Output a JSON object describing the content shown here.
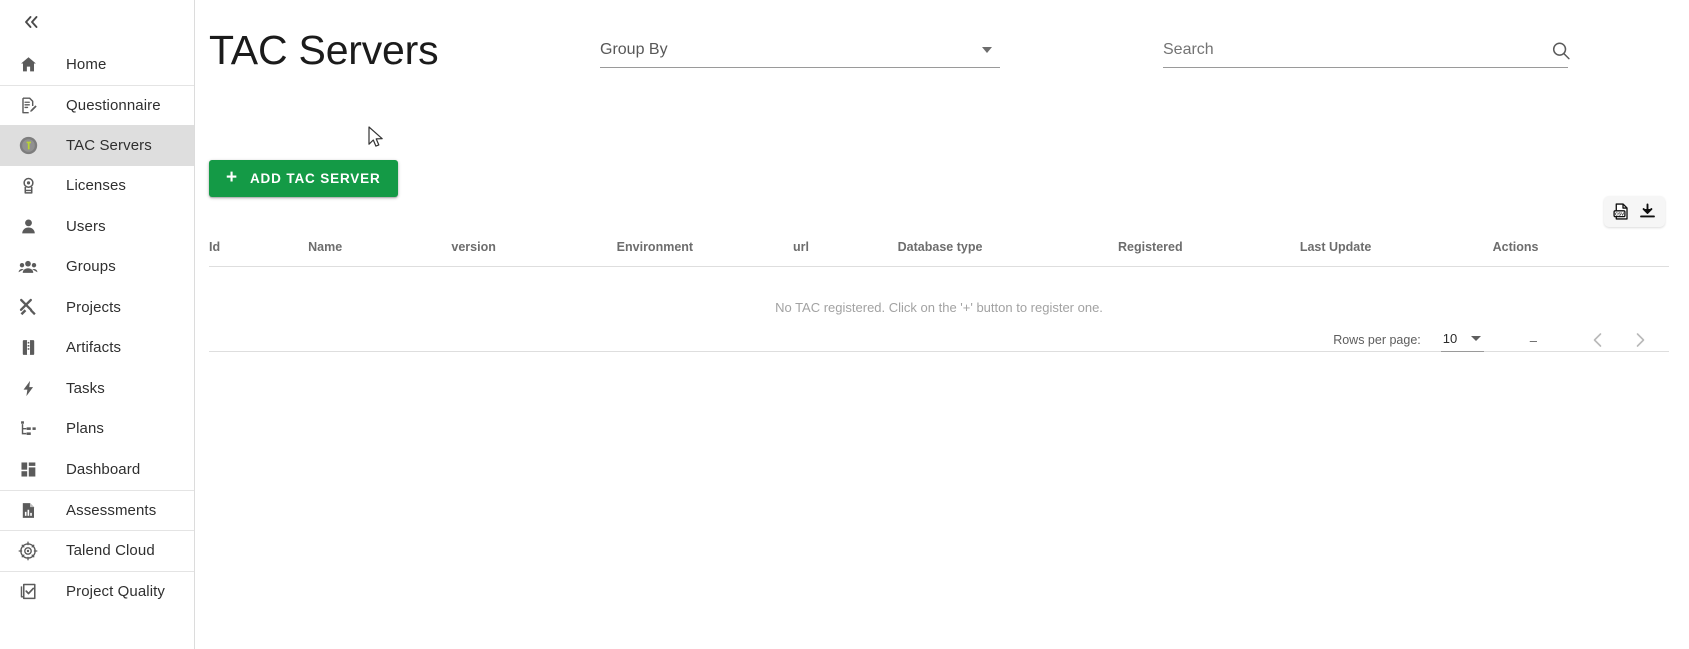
{
  "sidebar": {
    "collapse_icon": "chevron-double-left-icon",
    "items": [
      {
        "label": "Home",
        "icon": "home-icon",
        "active": false,
        "separator_above": false
      },
      {
        "label": "Questionnaire",
        "icon": "questionnaire-icon",
        "active": false,
        "separator_above": true
      },
      {
        "label": "TAC Servers",
        "icon": "talend-t-icon",
        "active": true,
        "separator_above": false
      },
      {
        "label": "Licenses",
        "icon": "license-badge-icon",
        "active": false,
        "separator_above": false
      },
      {
        "label": "Users",
        "icon": "user-icon",
        "active": false,
        "separator_above": false
      },
      {
        "label": "Groups",
        "icon": "groups-icon",
        "active": false,
        "separator_above": false
      },
      {
        "label": "Projects",
        "icon": "tools-icon",
        "active": false,
        "separator_above": false
      },
      {
        "label": "Artifacts",
        "icon": "artifact-icon",
        "active": false,
        "separator_above": false
      },
      {
        "label": "Tasks",
        "icon": "lightning-icon",
        "active": false,
        "separator_above": false
      },
      {
        "label": "Plans",
        "icon": "plan-tree-icon",
        "active": false,
        "separator_above": false
      },
      {
        "label": "Dashboard",
        "icon": "dashboard-icon",
        "active": false,
        "separator_above": false
      },
      {
        "label": "Assessments",
        "icon": "report-chart-icon",
        "active": false,
        "separator_above": true
      },
      {
        "label": "Talend Cloud",
        "icon": "cloud-target-icon",
        "active": false,
        "separator_above": true
      },
      {
        "label": "Project Quality",
        "icon": "quality-check-icon",
        "active": false,
        "separator_above": true
      }
    ]
  },
  "header": {
    "title": "TAC Servers",
    "group_by": {
      "label": "Group By",
      "value": "",
      "arrow_icon": "chevron-down-icon"
    },
    "search": {
      "placeholder": "Search",
      "value": "",
      "icon": "search-icon"
    }
  },
  "toolbar": {
    "add_button_label": "ADD TAC SERVER",
    "add_button_icon": "plus-icon",
    "add_button_color": "#149a46",
    "export": {
      "csv_icon": "csv-export-icon",
      "download_icon": "download-icon"
    }
  },
  "table": {
    "columns": [
      "Id",
      "Name",
      "version",
      "Environment",
      "url",
      "Database type",
      "Registered",
      "Last Update",
      "Actions"
    ],
    "rows": [],
    "empty_message": "No TAC registered. Click on the '+' button to register one."
  },
  "pagination": {
    "rows_per_page_label": "Rows per page:",
    "rows_per_page_value": "10",
    "rows_per_page_arrow": "chevron-down-icon",
    "range_text": "–",
    "prev_icon": "chevron-left-icon",
    "next_icon": "chevron-right-icon"
  }
}
